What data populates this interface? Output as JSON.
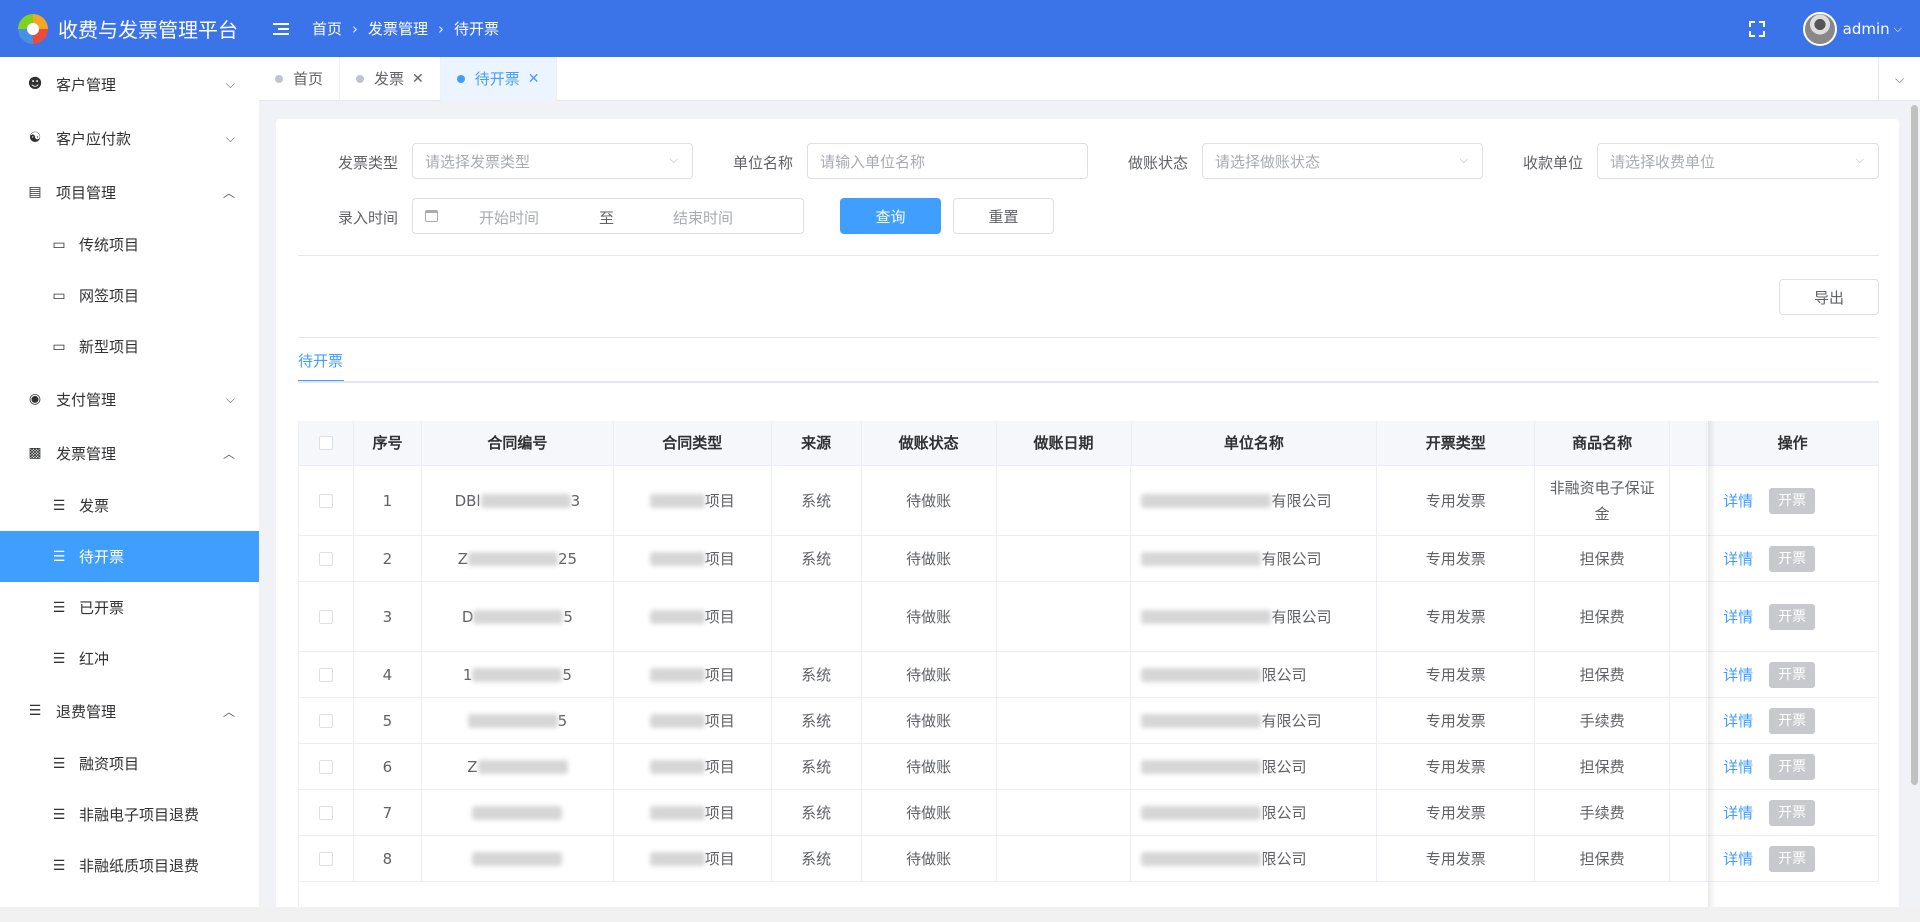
{
  "header": {
    "app_title": "收费与发票管理平台",
    "breadcrumb": [
      "首页",
      "发票管理",
      "待开票"
    ],
    "user_name": "admin"
  },
  "sidebar": {
    "items": [
      {
        "label": "客户管理",
        "icon": "user-icon",
        "expanded": false
      },
      {
        "label": "客户应付款",
        "icon": "payment-icon",
        "expanded": false
      },
      {
        "label": "项目管理",
        "icon": "document-icon",
        "expanded": true,
        "children": [
          "传统项目",
          "网签项目",
          "新型项目"
        ]
      },
      {
        "label": "支付管理",
        "icon": "pay-icon",
        "expanded": false
      },
      {
        "label": "发票管理",
        "icon": "invoice-icon",
        "expanded": true,
        "children": [
          "发票",
          "待开票",
          "已开票",
          "红冲"
        ]
      },
      {
        "label": "退费管理",
        "icon": "list-icon",
        "expanded": true,
        "children": [
          "融资项目",
          "非融电子项目退费",
          "非融纸质项目退费"
        ]
      }
    ],
    "active": "待开票"
  },
  "tabs": [
    {
      "label": "首页",
      "closable": false,
      "active": false
    },
    {
      "label": "发票",
      "closable": true,
      "active": false
    },
    {
      "label": "待开票",
      "closable": true,
      "active": true
    }
  ],
  "filters": {
    "invoice_type": {
      "label": "发票类型",
      "placeholder": "请选择发票类型"
    },
    "unit_name": {
      "label": "单位名称",
      "placeholder": "请输入单位名称"
    },
    "account_status": {
      "label": "做账状态",
      "placeholder": "请选择做账状态"
    },
    "payee_unit": {
      "label": "收款单位",
      "placeholder": "请选择收费单位"
    },
    "entry_time": {
      "label": "录入时间",
      "start": "开始时间",
      "to": "至",
      "end": "结束时间"
    },
    "query_label": "查询",
    "reset_label": "重置"
  },
  "export_label": "导出",
  "inner_tab": "待开票",
  "table": {
    "columns": [
      "序号",
      "合同编号",
      "合同类型",
      "来源",
      "做账状态",
      "做账日期",
      "单位名称",
      "开票类型",
      "商品名称",
      "操作"
    ],
    "detail_label": "详情",
    "issue_label": "开票",
    "rows": [
      {
        "no": "1",
        "contract_prefix": "DBl",
        "contract_suffix": "3",
        "type_suffix": "项目",
        "source": "系统",
        "status": "待做账",
        "date": "",
        "unit_suffix": "有限公司",
        "invoice_type": "专用发票",
        "goods": "非融资电子保证金"
      },
      {
        "no": "2",
        "contract_prefix": "Z",
        "contract_suffix": "25",
        "type_suffix": "项目",
        "source": "系统",
        "status": "待做账",
        "date": "",
        "unit_suffix": "有限公司",
        "invoice_type": "专用发票",
        "goods": "担保费"
      },
      {
        "no": "3",
        "contract_prefix": "D",
        "contract_suffix": "5",
        "type_suffix": "项目",
        "source": "",
        "status": "待做账",
        "date": "",
        "unit_suffix": "有限公司",
        "invoice_type": "专用发票",
        "goods": "担保费"
      },
      {
        "no": "4",
        "contract_prefix": "1",
        "contract_suffix": "5",
        "type_suffix": "项目",
        "source": "系统",
        "status": "待做账",
        "date": "",
        "unit_suffix": "限公司",
        "invoice_type": "专用发票",
        "goods": "担保费"
      },
      {
        "no": "5",
        "contract_prefix": "",
        "contract_suffix": "5",
        "type_suffix": "项目",
        "source": "系统",
        "status": "待做账",
        "date": "",
        "unit_suffix": "有限公司",
        "invoice_type": "专用发票",
        "goods": "手续费"
      },
      {
        "no": "6",
        "contract_prefix": "Z",
        "contract_suffix": "",
        "type_suffix": "项目",
        "source": "系统",
        "status": "待做账",
        "date": "",
        "unit_suffix": "限公司",
        "invoice_type": "专用发票",
        "goods": "担保费"
      },
      {
        "no": "7",
        "contract_prefix": "",
        "contract_suffix": "",
        "type_suffix": "项目",
        "source": "系统",
        "status": "待做账",
        "date": "",
        "unit_suffix": "限公司",
        "invoice_type": "专用发票",
        "goods": "手续费"
      },
      {
        "no": "8",
        "contract_prefix": "",
        "contract_suffix": "",
        "type_suffix": "项目",
        "source": "系统",
        "status": "待做账",
        "date": "",
        "unit_suffix": "限公司",
        "invoice_type": "专用发票",
        "goods": "担保费"
      }
    ]
  },
  "colors": {
    "header": "#3b73e8",
    "primary": "#409eff",
    "disabled": "#c8c9cc"
  }
}
